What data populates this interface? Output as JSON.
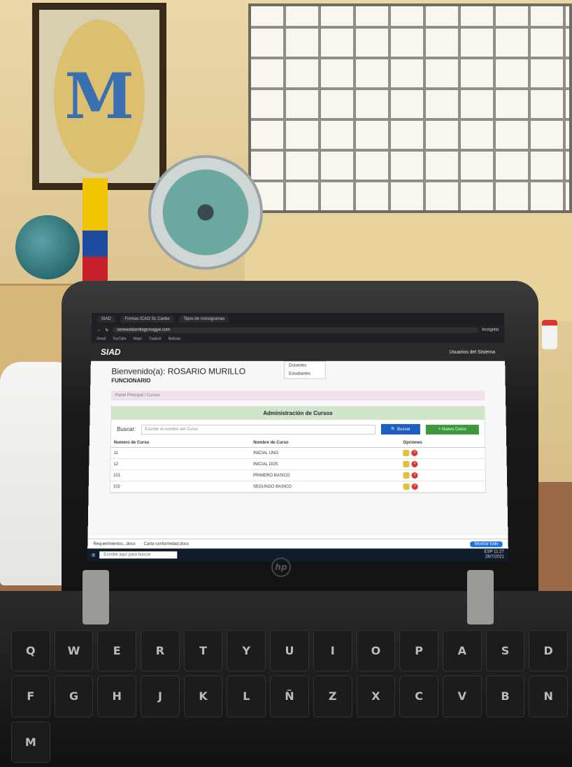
{
  "browser": {
    "tabs": [
      "SIAD",
      "Formas ICAO SL Caribe",
      "Tipos de cronogramas"
    ],
    "url": "lameadalamilagrosagye.com",
    "bookmarks": [
      "Gmail",
      "YouTube",
      "Maps",
      "Traducir",
      "Noticias"
    ],
    "profile": "Incógnito"
  },
  "app": {
    "brand": "SIAD",
    "nav_menu": "Usuarios del Sistema",
    "dropdown_items": [
      "Docentes",
      "Estudiantes"
    ],
    "welcome": "Bienvenido(a): ROSARIO MURILLO",
    "role": "FUNCIONARIO",
    "breadcrumb": [
      "Panel Principal",
      "Cursos"
    ],
    "card_title": "Administración de Cursos",
    "search_label": "Buscar:",
    "search_placeholder": "Escribir el nombre del Curso",
    "search_button": "Buscar",
    "new_button": "Nuevo Curso",
    "columns": [
      "Numero de Curso",
      "Nombre de Curso",
      "Opciones"
    ],
    "rows": [
      {
        "num": "11",
        "name": "INICIAL UNO"
      },
      {
        "num": "12",
        "name": "INICIAL DOS"
      },
      {
        "num": "101",
        "name": "PRIMERO BASICO"
      },
      {
        "num": "102",
        "name": "SEGUNDO BASICO"
      }
    ]
  },
  "downloads": {
    "items": [
      "Requerimientos...docx",
      "Carta conformidad.docx"
    ],
    "show_all": "Mostrar todo"
  },
  "taskbar": {
    "search_placeholder": "Escribe aquí para buscar",
    "lang": "ESP",
    "time": "11:27",
    "date": "26/7/2021"
  },
  "laptop": {
    "brand_logo": "hp",
    "keys": [
      "Q",
      "W",
      "E",
      "R",
      "T",
      "Y",
      "U",
      "I",
      "O",
      "P",
      "A",
      "S",
      "D",
      "F",
      "G",
      "H",
      "J",
      "K",
      "L",
      "Ñ",
      "Z",
      "X",
      "C",
      "V",
      "B",
      "N",
      "M"
    ]
  },
  "colors": {
    "navbar": "#2a2a2a",
    "card_head": "#cfe6c8",
    "search_btn": "#1f5fbf",
    "new_btn": "#3c9a3c"
  }
}
